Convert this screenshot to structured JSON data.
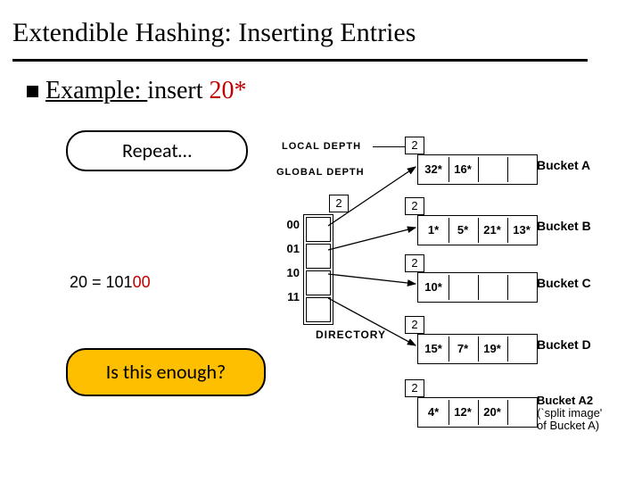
{
  "title": "Extendible Hashing: Inserting Entries",
  "example": {
    "prefix": "Example: ",
    "action": "insert ",
    "value": "20*"
  },
  "callouts": {
    "repeat": "Repeat…",
    "enough": "Is this enough?"
  },
  "calc": {
    "lhs": "20 = 101",
    "suffix_hl": "00"
  },
  "labels": {
    "local_depth": "LOCAL  DEPTH",
    "global_depth": "GLOBAL  DEPTH",
    "directory": "DIRECTORY"
  },
  "global_depth": "2",
  "directory": [
    "00",
    "01",
    "10",
    "11"
  ],
  "buckets": {
    "A": {
      "depth": "2",
      "cells": [
        "32*",
        "16*",
        "",
        ""
      ],
      "label": "Bucket A"
    },
    "B": {
      "depth": "2",
      "cells": [
        "1*",
        "5*",
        "21*",
        "13*"
      ],
      "label": "Bucket B"
    },
    "C": {
      "depth": "2",
      "cells": [
        "10*",
        "",
        "",
        ""
      ],
      "label": "Bucket C"
    },
    "D": {
      "depth": "2",
      "cells": [
        "15*",
        "7*",
        "19*",
        ""
      ],
      "label": "Bucket D"
    },
    "A2": {
      "depth": "2",
      "cells": [
        "4*",
        "12*",
        "20*",
        ""
      ],
      "label": "Bucket A2",
      "note": "(`split image'\nof Bucket A)"
    }
  }
}
